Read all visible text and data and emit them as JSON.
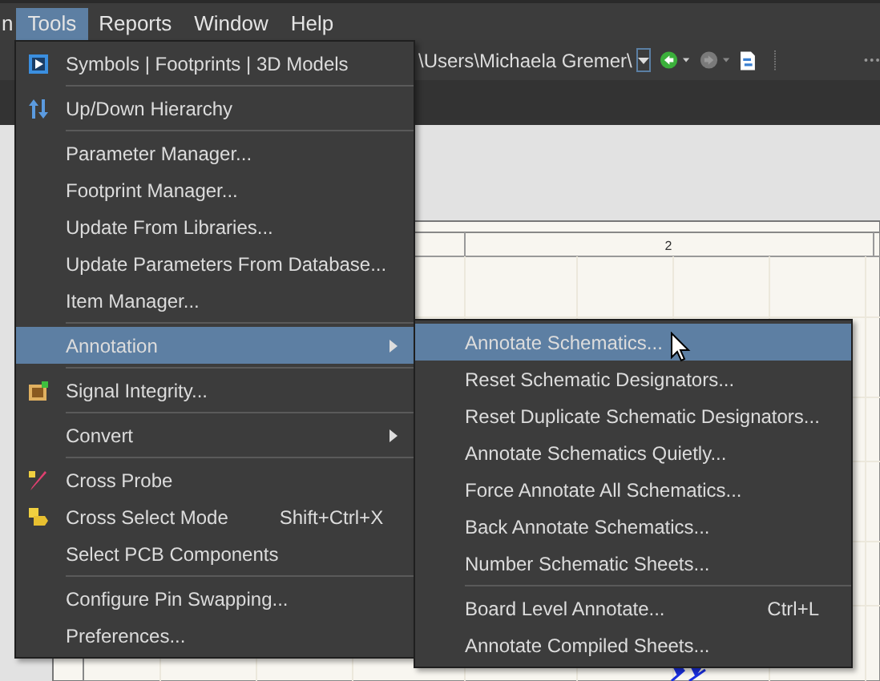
{
  "menubar": [
    {
      "label": "n",
      "selected": false
    },
    {
      "label": "Tools",
      "selected": true
    },
    {
      "label": "Reports",
      "selected": false
    },
    {
      "label": "Window",
      "selected": false
    },
    {
      "label": "Help",
      "selected": false
    }
  ],
  "toolbar": {
    "path": "\\Users\\Michaela Gremer\\"
  },
  "sheet": {
    "column_label": "2"
  },
  "tools_menu": {
    "items": [
      {
        "kind": "item",
        "label": "Symbols | Footprints | 3D Models",
        "submenu": false,
        "selected": false
      },
      {
        "kind": "separator"
      },
      {
        "kind": "item",
        "label": "Up/Down Hierarchy",
        "submenu": false,
        "selected": false
      },
      {
        "kind": "separator"
      },
      {
        "kind": "item",
        "label": "Parameter Manager...",
        "submenu": false,
        "selected": false
      },
      {
        "kind": "item",
        "label": "Footprint Manager...",
        "submenu": false,
        "selected": false
      },
      {
        "kind": "item",
        "label": "Update From Libraries...",
        "submenu": false,
        "selected": false
      },
      {
        "kind": "item",
        "label": "Update Parameters From Database...",
        "submenu": false,
        "selected": false
      },
      {
        "kind": "item",
        "label": "Item Manager...",
        "submenu": false,
        "selected": false
      },
      {
        "kind": "separator"
      },
      {
        "kind": "item",
        "label": "Annotation",
        "submenu": true,
        "selected": true
      },
      {
        "kind": "separator"
      },
      {
        "kind": "item",
        "label": "Signal Integrity...",
        "submenu": false,
        "selected": false
      },
      {
        "kind": "separator"
      },
      {
        "kind": "item",
        "label": "Convert",
        "submenu": true,
        "selected": false
      },
      {
        "kind": "separator"
      },
      {
        "kind": "item",
        "label": "Cross Probe",
        "submenu": false,
        "selected": false
      },
      {
        "kind": "item",
        "label": "Cross Select Mode",
        "shortcut": "Shift+Ctrl+X",
        "submenu": false,
        "selected": false
      },
      {
        "kind": "item",
        "label": "Select PCB Components",
        "submenu": false,
        "selected": false
      },
      {
        "kind": "separator"
      },
      {
        "kind": "item",
        "label": "Configure Pin Swapping...",
        "submenu": false,
        "selected": false
      },
      {
        "kind": "item",
        "label": "Preferences...",
        "submenu": false,
        "selected": false
      }
    ]
  },
  "annotation_submenu": {
    "items": [
      {
        "kind": "item",
        "label": "Annotate Schematics...",
        "selected": true
      },
      {
        "kind": "item",
        "label": "Reset Schematic Designators...",
        "selected": false
      },
      {
        "kind": "item",
        "label": "Reset Duplicate Schematic Designators...",
        "selected": false
      },
      {
        "kind": "item",
        "label": "Annotate Schematics Quietly...",
        "selected": false
      },
      {
        "kind": "item",
        "label": "Force Annotate All Schematics...",
        "selected": false
      },
      {
        "kind": "item",
        "label": "Back Annotate Schematics...",
        "selected": false
      },
      {
        "kind": "item",
        "label": "Number Schematic Sheets...",
        "selected": false
      },
      {
        "kind": "separator"
      },
      {
        "kind": "item",
        "label": "Board Level Annotate...",
        "shortcut": "Ctrl+L",
        "selected": false
      },
      {
        "kind": "item",
        "label": "Annotate Compiled Sheets...",
        "selected": false
      }
    ]
  }
}
